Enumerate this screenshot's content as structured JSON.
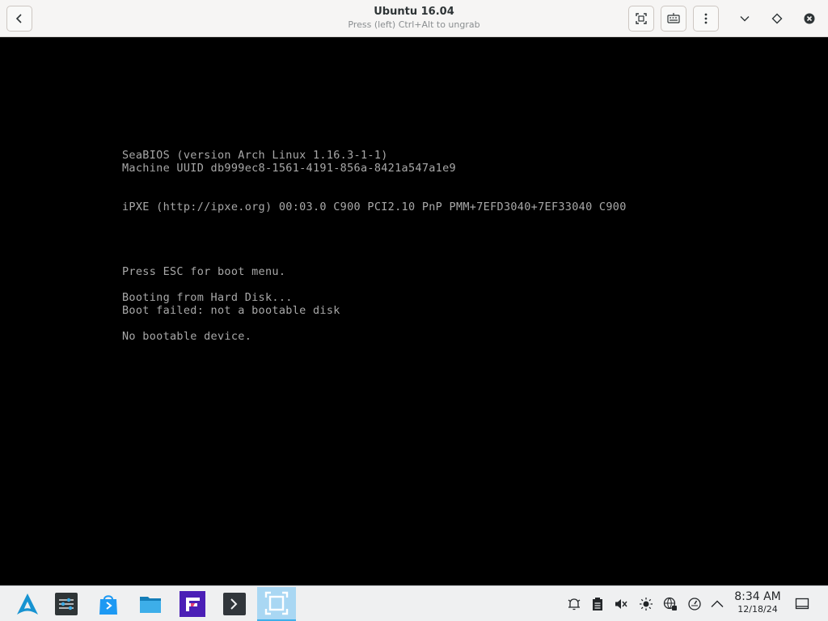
{
  "window": {
    "title": "Ubuntu 16.04",
    "subtitle": "Press (left) Ctrl+Alt to ungrab",
    "buttons": {
      "back_icon": "chevron-left-icon",
      "fullscreen_icon": "fullscreen-icon",
      "keyboard_icon": "keyboard-icon",
      "menu_icon": "kebab-menu-icon",
      "minimize_icon": "chevron-down-icon",
      "maximize_icon": "diamond-icon",
      "close_icon": "close-icon"
    }
  },
  "console": {
    "lines": [
      "SeaBIOS (version Arch Linux 1.16.3-1-1)",
      "Machine UUID db999ec8-1561-4191-856a-8421a547a1e9",
      "iPXE (http://ipxe.org) 00:03.0 C900 PCI2.10 PnP PMM+7EFD3040+7EF33040 C900",
      "Press ESC for boot menu.",
      "Booting from Hard Disk...",
      "Boot failed: not a bootable disk",
      "No bootable device."
    ],
    "text_color": "#a8a8a8",
    "background": "#000000"
  },
  "taskbar": {
    "launcher_icon": "arch-linux-logo-icon",
    "tasks": [
      {
        "name": "system-settings",
        "icon": "sliders-icon"
      },
      {
        "name": "discover",
        "icon": "shopping-bag-icon"
      },
      {
        "name": "file-manager",
        "icon": "folder-icon"
      },
      {
        "name": "freetube",
        "icon": "f-logo-icon"
      },
      {
        "name": "terminal",
        "icon": "terminal-icon"
      },
      {
        "name": "boxes",
        "icon": "boxes-icon",
        "active": true
      }
    ],
    "tray": [
      "notification-bell-icon",
      "clipboard-icon",
      "volume-muted-icon",
      "brightness-icon",
      "network-icon",
      "power-icon",
      "chevron-up-icon"
    ],
    "clock": {
      "time": "8:34 AM",
      "date": "12/18/24"
    },
    "show_desktop_icon": "show-desktop-icon"
  },
  "colors": {
    "accent": "#3daee9",
    "taskbar_bg": "#eff0f1",
    "header_bg": "#f6f5f4"
  }
}
